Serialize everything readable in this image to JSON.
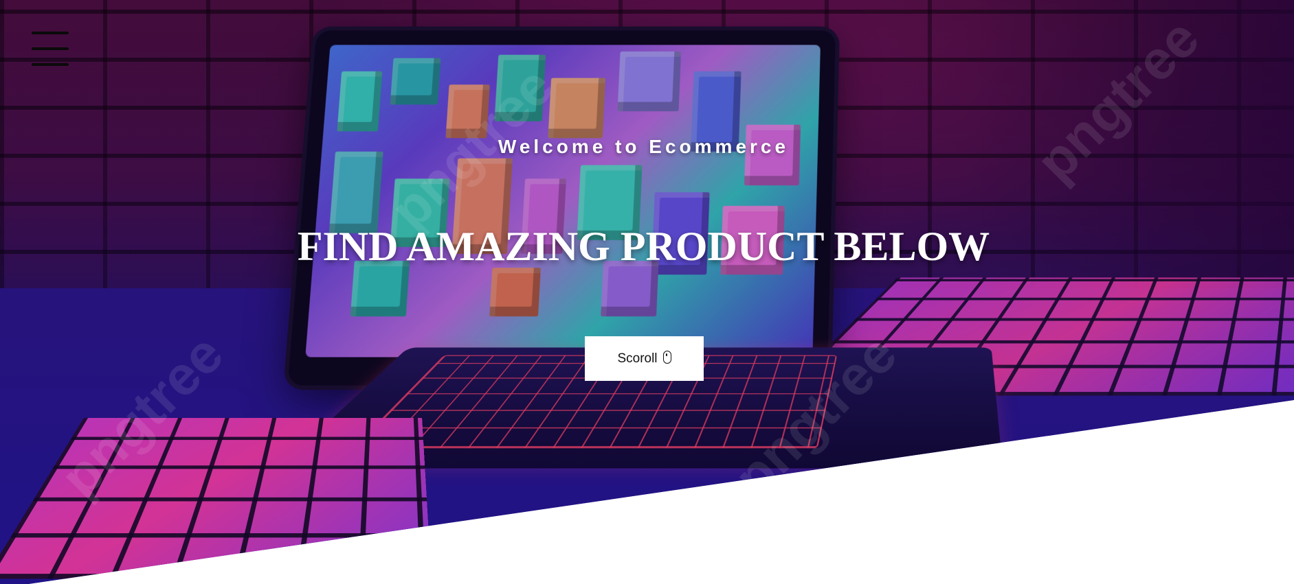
{
  "hero": {
    "welcome_text": "Welcome to Ecommerce",
    "headline": "FIND AMAZING PRODUCT BELOW",
    "scroll_button_label": "Scoroll",
    "watermark_text": "pngtree"
  },
  "icons": {
    "menu": "hamburger-menu-icon",
    "scroll": "mouse-icon"
  },
  "colors": {
    "button_bg": "#ffffff",
    "text": "#ffffff",
    "menu_icon": "#0a0a0a",
    "page_bg": "#ffffff"
  }
}
